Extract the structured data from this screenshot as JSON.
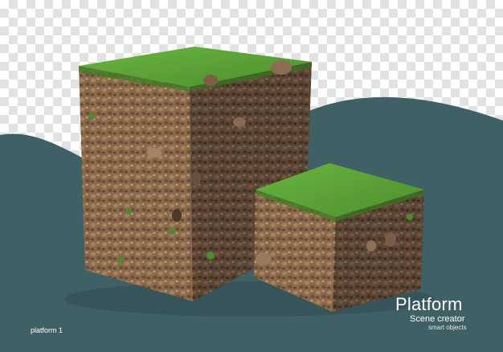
{
  "image": {
    "subject": "platform",
    "colors": {
      "background_teal": "#3f6166",
      "grass": "#5aa035",
      "soil_light": "#8b6a4c",
      "soil_dark": "#5a4434"
    }
  },
  "text": {
    "title": "Platform",
    "subtitle": "Scene creator",
    "subtitle2": "smart objects",
    "caption": "platform 1"
  }
}
